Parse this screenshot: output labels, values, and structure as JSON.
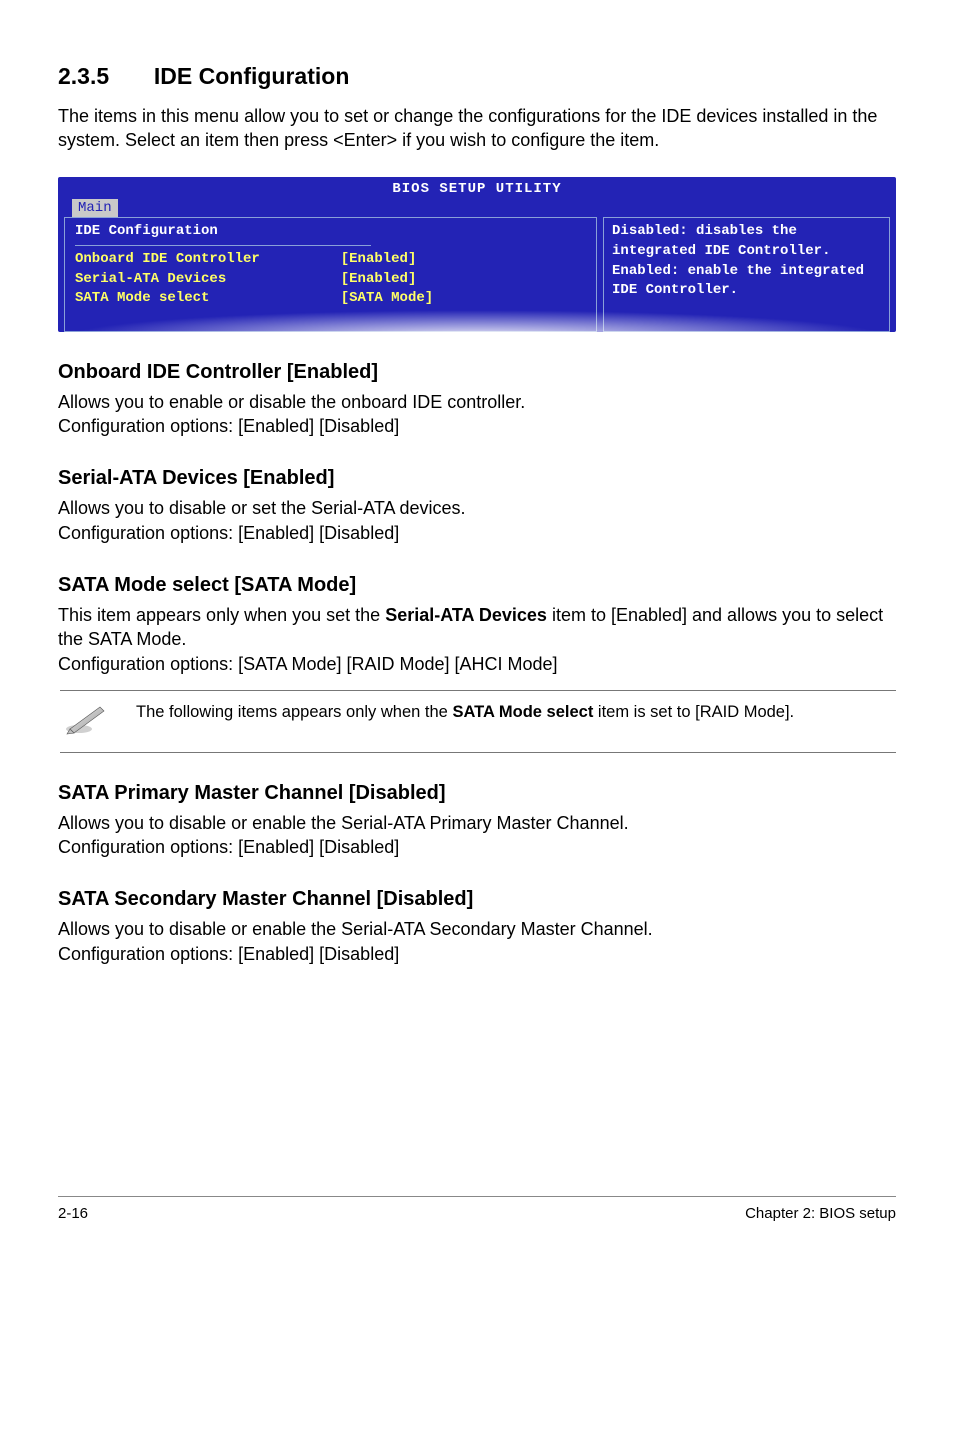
{
  "section": {
    "number": "2.3.5",
    "title": "IDE Configuration"
  },
  "intro": "The items in this menu allow you to set or change the configurations for the IDE devices installed in the system. Select an item then press <Enter> if you wish to configure the item.",
  "bios": {
    "title": "BIOS SETUP UTILITY",
    "tab": "Main",
    "left_heading": "IDE Configuration",
    "rows": [
      {
        "label": "Onboard IDE Controller",
        "value": "[Enabled]"
      },
      {
        "label": "Serial-ATA Devices",
        "value": "[Enabled]"
      },
      {
        "label": "SATA Mode select",
        "value": "[SATA Mode]"
      }
    ],
    "help": "Disabled: disables the integrated IDE Controller.\nEnabled: enable the integrated IDE Controller."
  },
  "subsections": [
    {
      "heading": "Onboard IDE Controller [Enabled]",
      "body": "Allows you to enable or disable the onboard IDE controller.\nConfiguration options: [Enabled] [Disabled]"
    },
    {
      "heading": "Serial-ATA Devices [Enabled]",
      "body": "Allows you to disable or set the Serial-ATA devices.\nConfiguration options: [Enabled] [Disabled]"
    },
    {
      "heading": "SATA Mode select [SATA Mode]",
      "body": "This item appears only when you set the Serial-ATA Devices item to [Enabled] and allows you to select the SATA Mode.\nConfiguration options: [SATA Mode] [RAID Mode] [AHCI Mode]",
      "bold_inline": "Serial-ATA Devices"
    }
  ],
  "note": {
    "text": "The following items appears only when the SATA Mode select item is set to [RAID Mode].",
    "bold_inline": "SATA Mode select"
  },
  "subsections2": [
    {
      "heading": "SATA Primary Master Channel [Disabled]",
      "body": "Allows you to disable or enable the Serial-ATA Primary Master Channel.\nConfiguration options: [Enabled] [Disabled]"
    },
    {
      "heading": "SATA Secondary Master Channel [Disabled]",
      "body": "Allows you to disable or enable the Serial-ATA Secondary Master Channel.\nConfiguration options: [Enabled] [Disabled]"
    }
  ],
  "footer": {
    "left": "2-16",
    "right": "Chapter 2: BIOS setup"
  }
}
